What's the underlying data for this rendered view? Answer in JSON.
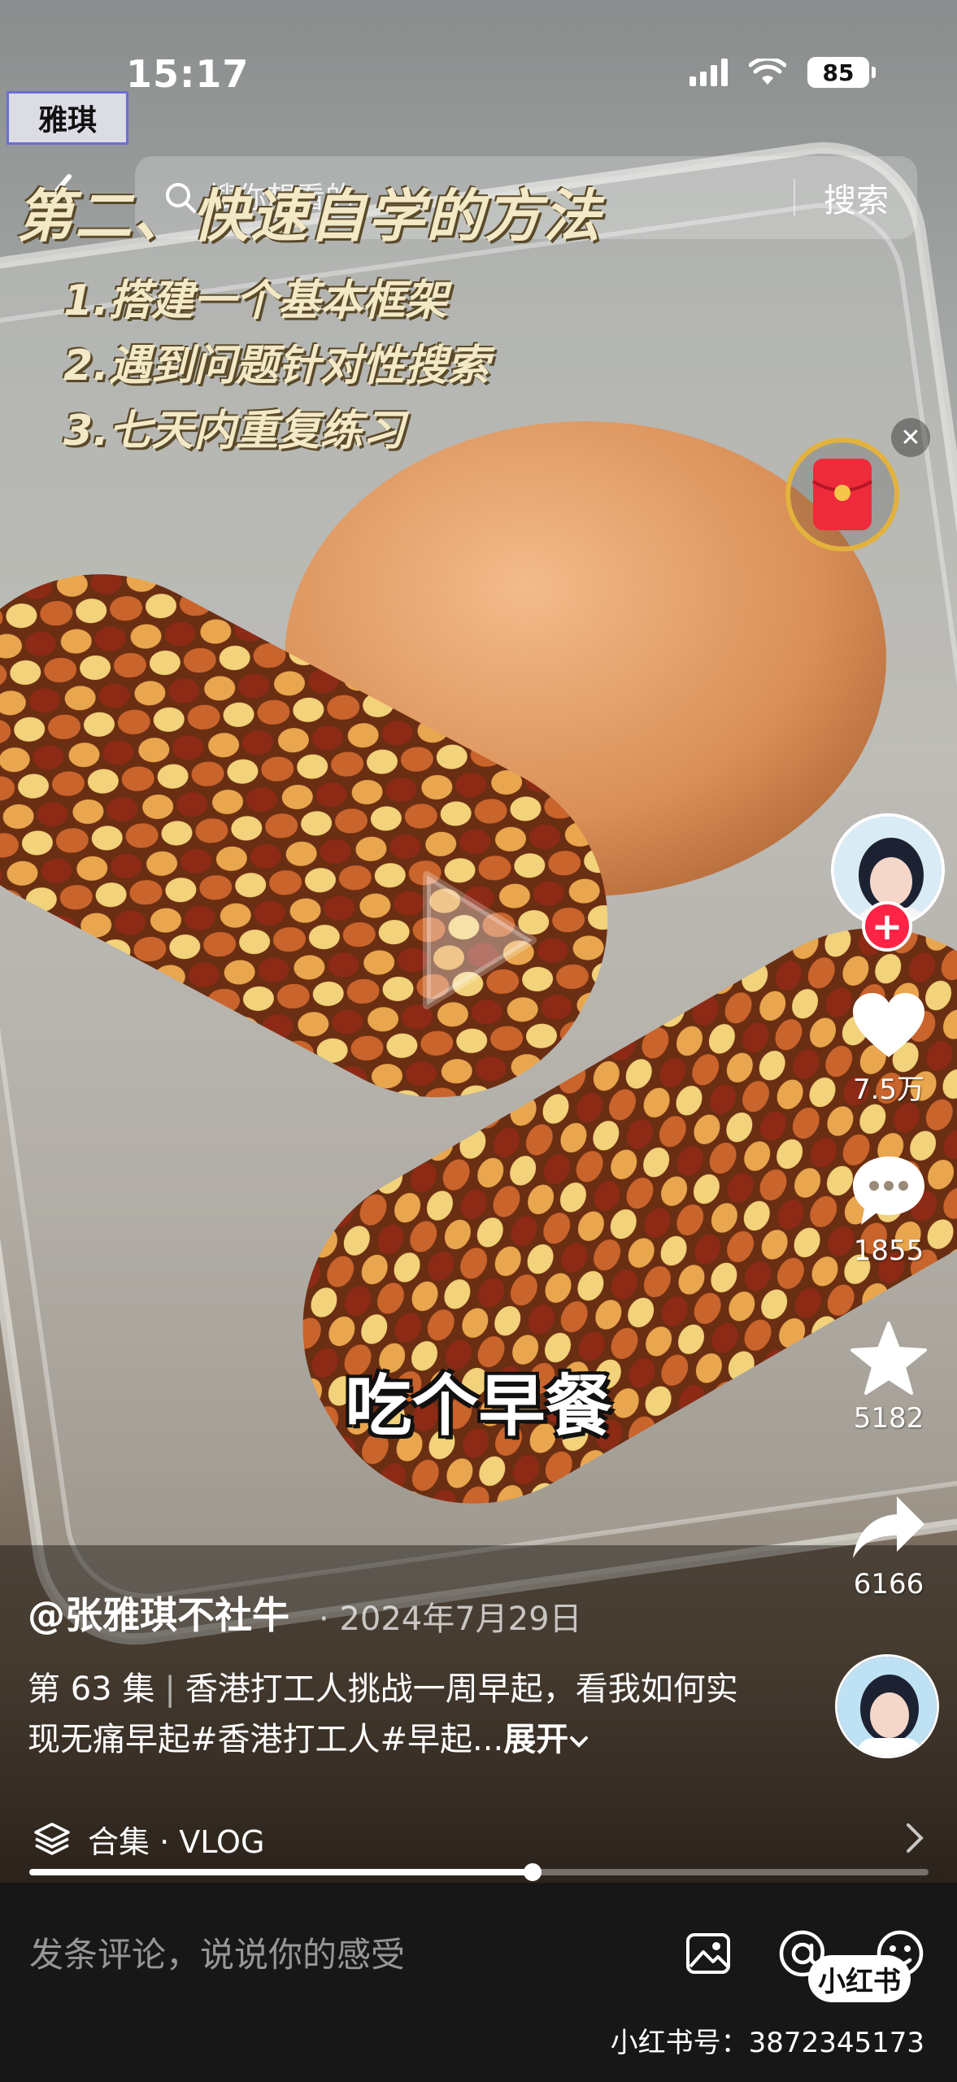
{
  "status_bar": {
    "time": "15:17",
    "battery": "85"
  },
  "corner_tag": "雅琪",
  "search": {
    "placeholder": "搜你想看的",
    "button_label": "搜索"
  },
  "overlay": {
    "title": "第二、快速自学的方法",
    "list": [
      "1.搭建一个基本框架",
      "2.遇到问题针对性搜索",
      "3.七天内重复练习"
    ],
    "subtitle": "吃个早餐"
  },
  "actions": {
    "like_count": "7.5万",
    "comment_count": "1855",
    "star_count": "5182",
    "share_count": "6166"
  },
  "post": {
    "author": "@张雅琪不社牛",
    "date": "· 2024年7月29日",
    "episode": "第 63 集",
    "separator": "|",
    "description": "香港打工人挑战一周早起，看我如何实现无痛早起#香港打工人#早起...",
    "expand_label": "展开"
  },
  "collection": {
    "label": "合集 · VLOG"
  },
  "progress": {
    "played_fraction": 0.56
  },
  "comment_bar": {
    "placeholder": "发条评论，说说你的感受"
  },
  "watermark": {
    "logo_text": "小红书",
    "user_id": "小红书号：3872345173"
  },
  "colors": {
    "follow_red": "#ff2446",
    "redpacket_gold": "#e3b23c",
    "caption_yellow": "#f4e9c6",
    "bottom_bar": "#171717"
  },
  "icons": [
    "back-icon",
    "search-icon",
    "red-envelope-icon",
    "close-icon",
    "play-icon",
    "heart-icon",
    "comment-icon",
    "star-icon",
    "share-icon",
    "layers-icon",
    "chevron-right-icon",
    "image-icon",
    "at-icon",
    "emoji-icon",
    "chevron-down-icon"
  ]
}
